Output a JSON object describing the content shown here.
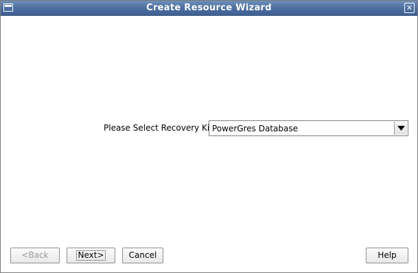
{
  "window": {
    "title": "Create Resource Wizard"
  },
  "form": {
    "label": "Please Select Recovery Kit",
    "selected_value": "PowerGres Database"
  },
  "buttons": {
    "back": "<Back",
    "next": "Next>",
    "cancel": "Cancel",
    "help": "Help"
  }
}
